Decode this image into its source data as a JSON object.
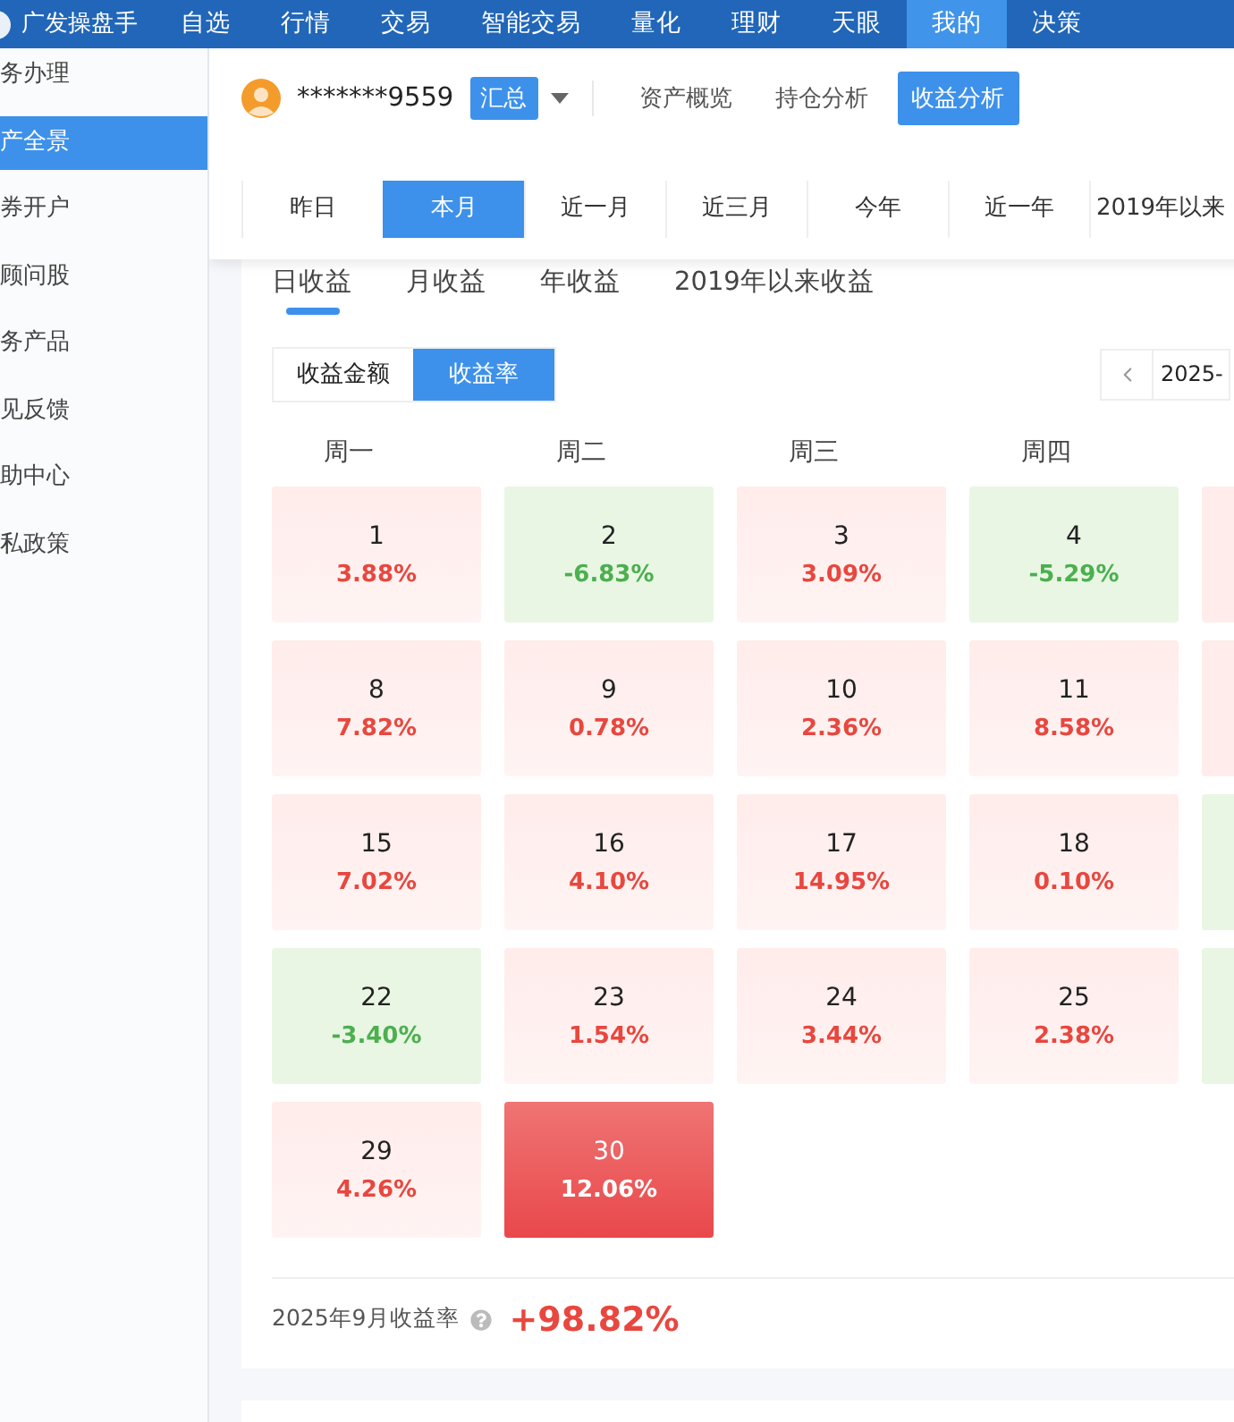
{
  "nav": {
    "brand": "广发操盘手",
    "items": [
      {
        "label": "自选",
        "selected": false
      },
      {
        "label": "行情",
        "selected": false
      },
      {
        "label": "交易",
        "selected": false
      },
      {
        "label": "智能交易",
        "selected": false
      },
      {
        "label": "量化",
        "selected": false
      },
      {
        "label": "理财",
        "selected": false
      },
      {
        "label": "天眼",
        "selected": false
      },
      {
        "label": "我的",
        "selected": true
      },
      {
        "label": "决策",
        "selected": false
      }
    ]
  },
  "sidebar": {
    "items": [
      {
        "label": "务办理",
        "selected": false
      },
      {
        "label": "产全景",
        "selected": true
      },
      {
        "label": "券开户",
        "selected": false
      },
      {
        "label": "顾问股",
        "selected": false
      },
      {
        "label": "务产品",
        "selected": false
      },
      {
        "label": "见反馈",
        "selected": false
      },
      {
        "label": "助中心",
        "selected": false
      },
      {
        "label": "私政策",
        "selected": false
      }
    ]
  },
  "account": {
    "number": "*******9559",
    "badge": "汇总"
  },
  "view_tabs": [
    {
      "label": "资产概览",
      "selected": false
    },
    {
      "label": "持仓分析",
      "selected": false
    },
    {
      "label": "收益分析",
      "selected": true
    }
  ],
  "periods": [
    {
      "label": "昨日",
      "selected": false
    },
    {
      "label": "本月",
      "selected": true
    },
    {
      "label": "近一月",
      "selected": false
    },
    {
      "label": "近三月",
      "selected": false
    },
    {
      "label": "今年",
      "selected": false
    },
    {
      "label": "近一年",
      "selected": false
    },
    {
      "label": "2019年以来",
      "selected": false
    }
  ],
  "profit_tabs": [
    {
      "label": "日收益",
      "selected": true
    },
    {
      "label": "月收益",
      "selected": false
    },
    {
      "label": "年收益",
      "selected": false
    },
    {
      "label": "2019年以来收益",
      "selected": false
    }
  ],
  "mode_toggle": [
    {
      "label": "收益金额",
      "selected": false
    },
    {
      "label": "收益率",
      "selected": true
    }
  ],
  "month_picker": {
    "value": "2025-"
  },
  "weekdays": [
    "周一",
    "周二",
    "周三",
    "周四"
  ],
  "days": [
    {
      "day": "1",
      "value": "3.88%",
      "gain": true,
      "selected": false
    },
    {
      "day": "2",
      "value": "-6.83%",
      "gain": false,
      "selected": false
    },
    {
      "day": "3",
      "value": "3.09%",
      "gain": true,
      "selected": false
    },
    {
      "day": "4",
      "value": "-5.29%",
      "gain": false,
      "selected": false
    },
    {
      "kind": "partial",
      "color": "#ffeceb"
    },
    {
      "day": "8",
      "value": "7.82%",
      "gain": true,
      "selected": false
    },
    {
      "day": "9",
      "value": "0.78%",
      "gain": true,
      "selected": false
    },
    {
      "day": "10",
      "value": "2.36%",
      "gain": true,
      "selected": false
    },
    {
      "day": "11",
      "value": "8.58%",
      "gain": true,
      "selected": false
    },
    {
      "kind": "partial",
      "color": "#ffeceb"
    },
    {
      "day": "15",
      "value": "7.02%",
      "gain": true,
      "selected": false
    },
    {
      "day": "16",
      "value": "4.10%",
      "gain": true,
      "selected": false
    },
    {
      "day": "17",
      "value": "14.95%",
      "gain": true,
      "selected": false
    },
    {
      "day": "18",
      "value": "0.10%",
      "gain": true,
      "selected": false
    },
    {
      "kind": "partial",
      "color": "#e9f6e3"
    },
    {
      "day": "22",
      "value": "-3.40%",
      "gain": false,
      "selected": false
    },
    {
      "day": "23",
      "value": "1.54%",
      "gain": true,
      "selected": false
    },
    {
      "day": "24",
      "value": "3.44%",
      "gain": true,
      "selected": false
    },
    {
      "day": "25",
      "value": "2.38%",
      "gain": true,
      "selected": false
    },
    {
      "kind": "partial",
      "color": "#e9f6e3"
    },
    {
      "day": "29",
      "value": "4.26%",
      "gain": true,
      "selected": false
    },
    {
      "day": "30",
      "value": "12.06%",
      "gain": true,
      "selected": true
    }
  ],
  "summary": {
    "label": "2025年9月收益率",
    "value": "+98.82%"
  }
}
